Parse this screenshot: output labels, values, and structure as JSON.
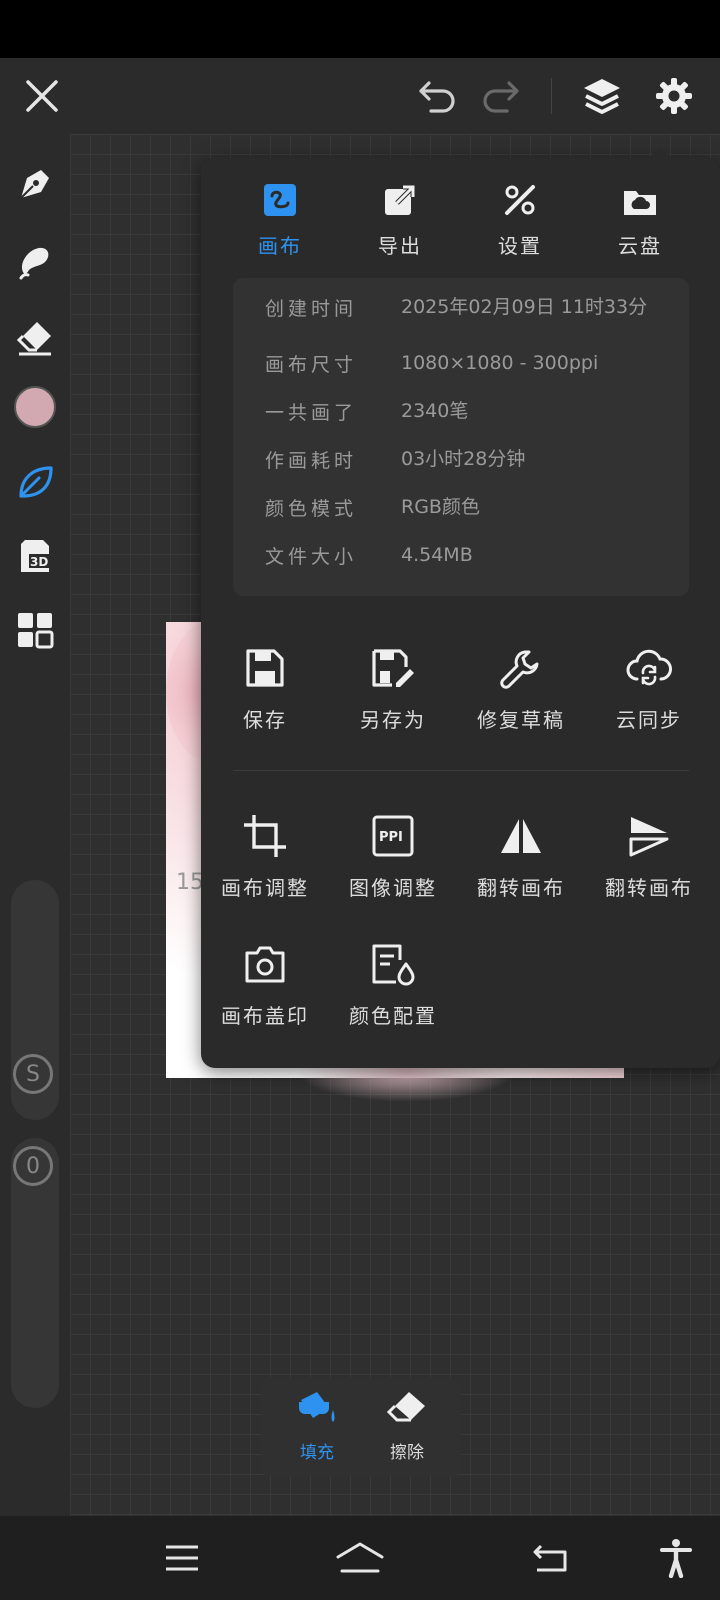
{
  "popup": {
    "tabs": [
      {
        "label": "画布",
        "icon": "canvas-icon",
        "active": true
      },
      {
        "label": "导出",
        "icon": "export-icon",
        "active": false
      },
      {
        "label": "设置",
        "icon": "settings-icon",
        "active": false
      },
      {
        "label": "云盘",
        "icon": "cloud-drive-icon",
        "active": false
      }
    ],
    "info": [
      {
        "key": "创建时间",
        "value": "2025年02月09日 11时33分"
      },
      {
        "key": "画布尺寸",
        "value": "1080×1080 - 300ppi"
      },
      {
        "key": "一共画了",
        "value": "2340笔"
      },
      {
        "key": "作画耗时",
        "value": "03小时28分钟"
      },
      {
        "key": "颜色模式",
        "value": "RGB颜色"
      },
      {
        "key": "文件大小",
        "value": "4.54MB"
      }
    ],
    "actions_row1": [
      {
        "label": "保存",
        "icon": "save-icon"
      },
      {
        "label": "另存为",
        "icon": "save-as-icon"
      },
      {
        "label": "修复草稿",
        "icon": "wrench-icon"
      },
      {
        "label": "云同步",
        "icon": "cloud-sync-icon"
      }
    ],
    "actions_row2": [
      {
        "label": "画布调整",
        "icon": "crop-icon"
      },
      {
        "label": "图像调整",
        "icon": "ppi-icon"
      },
      {
        "label": "翻转画布",
        "icon": "flip-horizontal-icon"
      },
      {
        "label": "翻转画布",
        "icon": "flip-vertical-icon"
      }
    ],
    "actions_row3": [
      {
        "label": "画布盖印",
        "icon": "camera-icon"
      },
      {
        "label": "颜色配置",
        "icon": "color-config-icon"
      }
    ]
  },
  "canvas": {
    "partial_text": "15"
  },
  "sidebar": {
    "current_color": "#d2a9b0",
    "size_knob": "S",
    "opacity_knob": "0"
  },
  "bottom_tools": [
    {
      "label": "填充",
      "icon": "paint-bucket-icon",
      "active": true
    },
    {
      "label": "擦除",
      "icon": "eraser-icon",
      "active": false
    }
  ],
  "colors": {
    "accent": "#2e93f0"
  }
}
